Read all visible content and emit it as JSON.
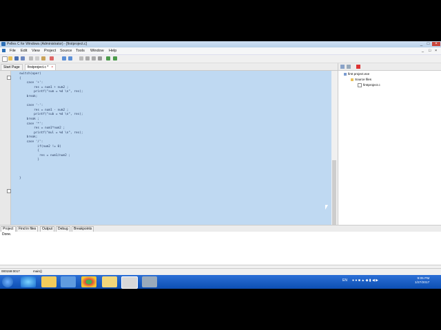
{
  "window": {
    "title": "Pelles C for Windows (Administrator) - [firstproject.c]",
    "controls": [
      "_",
      "□",
      "×"
    ]
  },
  "menu": [
    "File",
    "Edit",
    "View",
    "Project",
    "Source",
    "Tools",
    "Window",
    "Help"
  ],
  "tabs": [
    {
      "label": "Start Page"
    },
    {
      "label": "firstproject.c *",
      "close": "×"
    }
  ],
  "code_lines": [
    "switch(oper)",
    "{",
    "    case '+':",
    "        res = num1 + num2 ;",
    "        printf(\"sum = %d \\n\", res);",
    "    break;",
    "",
    "    case '-':",
    "        res = num1 - num2 ;",
    "        printf(\"sub = %d \\n\", res);",
    "    break ;",
    "    case '*':",
    "        res = num1*num2 ;",
    "        printf(\"mul = %d \\n\", res);",
    "    break;",
    "    case '/':",
    "          if(num2 != 0)",
    "          {",
    "           res = num1/num2 ;",
    "          }",
    "",
    "",
    "",
    "}"
  ],
  "project_tree": {
    "root": "first project.exe",
    "folder": "Source files",
    "file": "firstproject.c"
  },
  "bottom_tabs": [
    "Project",
    "Find in files",
    "Output",
    "Debug",
    "Breakpoints"
  ],
  "output_text": "Done.",
  "status": {
    "position": "000159:0017",
    "function": "main()"
  },
  "taskbar": {
    "lang": "EN",
    "time": "9:05 PM",
    "date": "1/27/2017"
  },
  "colors": {
    "editor_bg": "#bfd9f2",
    "taskbar": "#1b5fc4"
  }
}
